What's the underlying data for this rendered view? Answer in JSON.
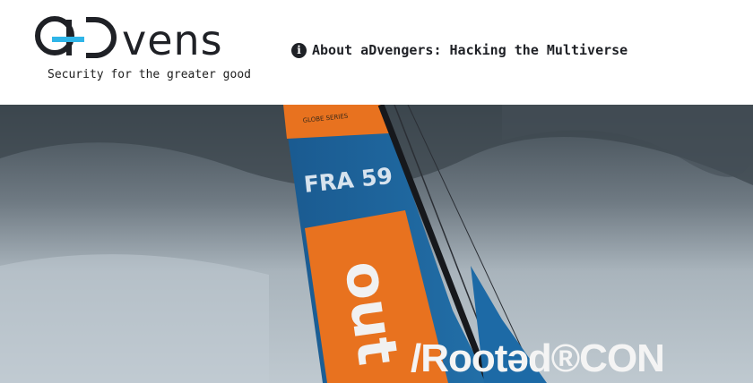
{
  "header": {
    "logo_alt": "aDvens",
    "tagline": "Security for the greater good",
    "nav_link": {
      "icon": "info-circle-icon",
      "label": "About aDvengers: Hacking the Multiverse"
    }
  },
  "hero": {
    "sail_number": "FRA 59",
    "sail_brand": "out",
    "sail_small_text": "GLOBE SERIES",
    "event_logo": "/Rootəd®CON"
  },
  "colors": {
    "logo_dark": "#1f2126",
    "logo_accent": "#2fb5e8",
    "sail_orange": "#e8721f",
    "sail_blue": "#1a5f98",
    "sky_dark": "#4f5a63",
    "sky_light": "#b7c2ca"
  }
}
